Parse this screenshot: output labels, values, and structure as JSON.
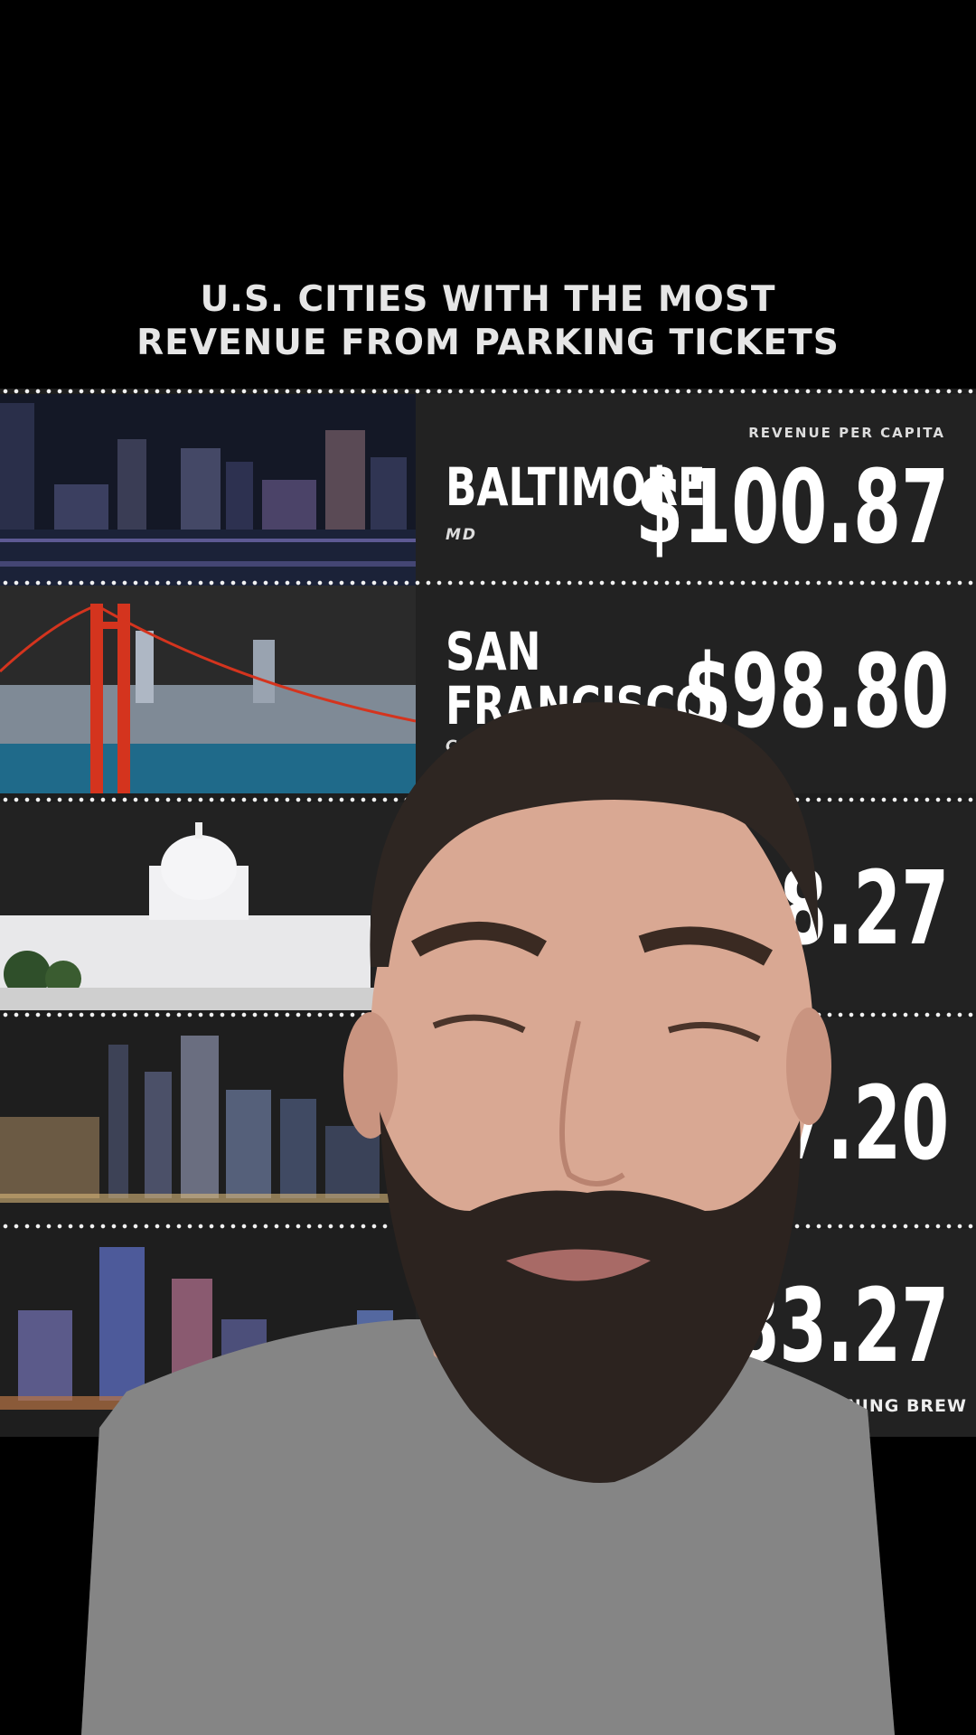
{
  "title": {
    "line1": "U.S. CITIES WITH THE MOST",
    "line2": "REVENUE FROM PARKING TICKETS"
  },
  "revenue_label": "REVENUE PER CAPITA",
  "rows": [
    {
      "city": "BALTIMORE",
      "state": "MD",
      "value": "$100.87"
    },
    {
      "city_line1": "SAN",
      "city_line2": "FRANCISCO",
      "state": "CA",
      "value": "$98.80"
    },
    {
      "value": "$88.27"
    },
    {
      "value": "$87.20"
    },
    {
      "value": "$83.27"
    }
  ],
  "source": "MORNING BREW",
  "colors": {
    "background": "#000000",
    "panel": "#222222",
    "text": "#ffffff",
    "bridge": "#d4341e"
  }
}
